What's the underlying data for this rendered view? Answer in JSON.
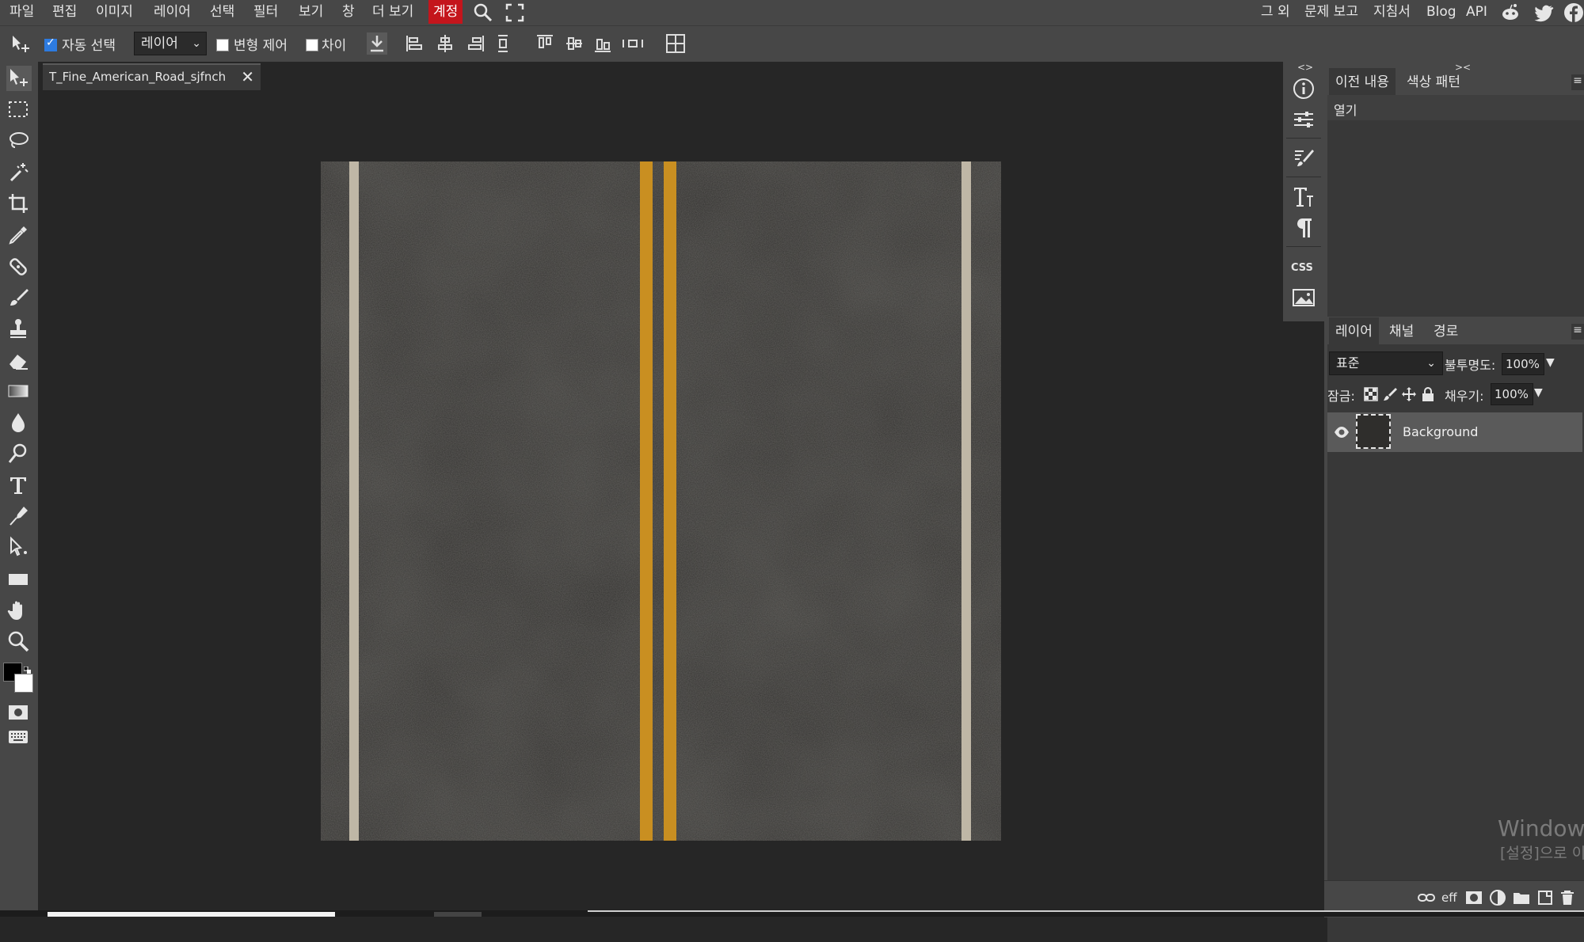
{
  "menubar": {
    "items": [
      "파일",
      "편집",
      "이미지",
      "레이어",
      "선택",
      "필터",
      "보기",
      "창",
      "더 보기",
      "계정"
    ],
    "right_links": [
      "그 외",
      "문제 보고",
      "지침서",
      "Blog",
      "API"
    ],
    "accent_color": "#c4151c"
  },
  "options_bar": {
    "auto_select_label": "자동 선택",
    "auto_select_checked": true,
    "target_select": "레이어",
    "transform_label": "변형 제어",
    "distance_label": "차이"
  },
  "document": {
    "tab_title": "T_Fine_American_Road_sjfnch",
    "close_glyph": "✕"
  },
  "history_panel": {
    "tabs": [
      "이전 내용",
      "색상 패턴"
    ],
    "entries": [
      "열기"
    ]
  },
  "layers_panel": {
    "tabs": [
      "레이어",
      "채널",
      "경로"
    ],
    "blend_mode": "표준",
    "opacity_label": "불투명도:",
    "opacity_value": "100%",
    "lock_label": "잠금:",
    "fill_label": "채우기:",
    "fill_value": "100%",
    "layers": [
      {
        "name": "Background",
        "visible": true
      }
    ]
  },
  "watermark": {
    "line1": "Windows",
    "line2": "[설정]으로 이"
  },
  "right_tools": {
    "css_label": "CSS",
    "collapse_left": "<>",
    "collapse_right": "><"
  }
}
